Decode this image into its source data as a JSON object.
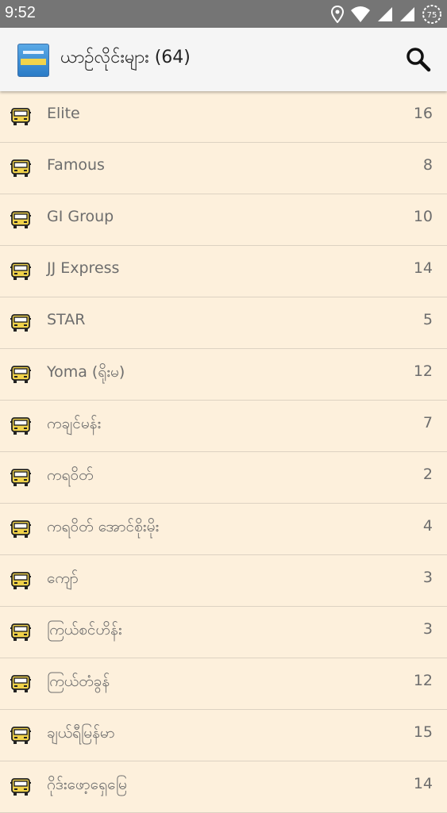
{
  "status_bar": {
    "time": "9:52",
    "battery": "75"
  },
  "app_bar": {
    "title": "ယာဉ်လိုင်းများ (64)",
    "logo_icon": "app-logo-icon",
    "search_icon": "search-icon"
  },
  "list": {
    "rows": [
      {
        "name": "Elite",
        "count": "16"
      },
      {
        "name": "Famous",
        "count": "8"
      },
      {
        "name": "GI Group",
        "count": "10"
      },
      {
        "name": "JJ Express",
        "count": "14"
      },
      {
        "name": "STAR",
        "count": "5"
      },
      {
        "name": "Yoma (ရိုးမ)",
        "count": "12"
      },
      {
        "name": "ကချင်မန်း",
        "count": "7"
      },
      {
        "name": "ကရဝိတ်",
        "count": "2"
      },
      {
        "name": "ကရဝိတ် အောင်စိုးမိုး",
        "count": "4"
      },
      {
        "name": "ကျော်",
        "count": "3"
      },
      {
        "name": "ကြယ်စင်ဟိန်း",
        "count": "3"
      },
      {
        "name": "ကြယ်တံခွန်",
        "count": "12"
      },
      {
        "name": "ချယ်ရီမြန်မာ",
        "count": "15"
      },
      {
        "name": "ဂိုဒ်းဖော့ရှေမြေ",
        "count": "14"
      }
    ]
  },
  "colors": {
    "row_bg": "#fdf0dc",
    "status_bar": "#757575",
    "app_bar": "#f5f5f5"
  }
}
